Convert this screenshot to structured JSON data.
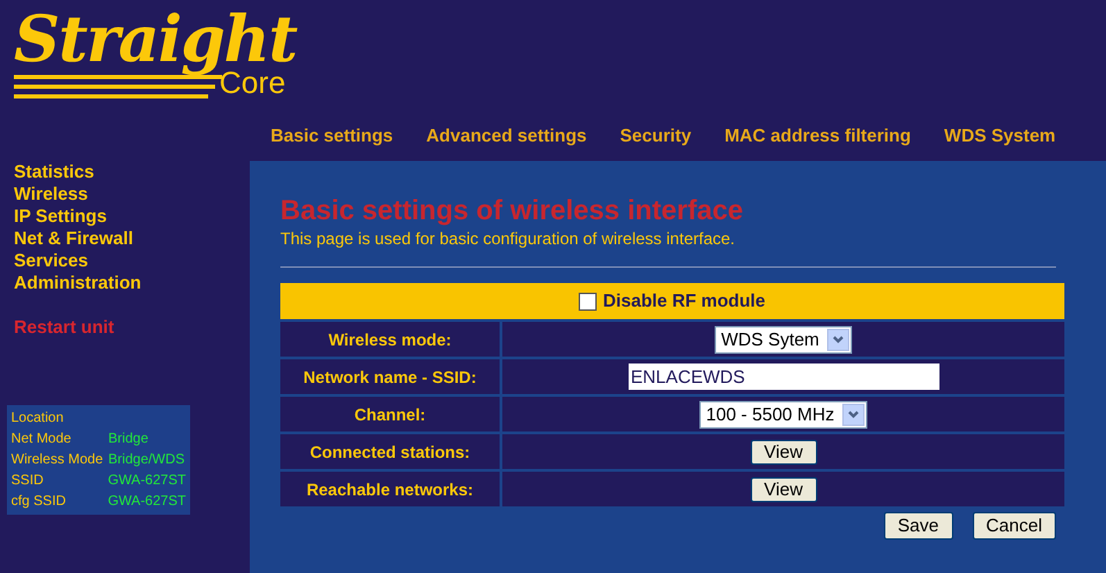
{
  "logo": {
    "name": "Straight",
    "tagline": "Core"
  },
  "nav": [
    "Basic settings",
    "Advanced settings",
    "Security",
    "MAC address filtering",
    "WDS System"
  ],
  "sidebar": {
    "items": [
      {
        "label": "Statistics",
        "kind": "link"
      },
      {
        "label": "Wireless",
        "kind": "link"
      },
      {
        "label": "IP Settings",
        "kind": "link"
      },
      {
        "label": "Net & Firewall",
        "kind": "link"
      },
      {
        "label": "Services",
        "kind": "link"
      },
      {
        "label": "Administration",
        "kind": "link"
      },
      {
        "label": "Restart unit",
        "kind": "action"
      }
    ]
  },
  "status": {
    "title": "Location",
    "rows": [
      {
        "label": "Net Mode",
        "value": "Bridge"
      },
      {
        "label": "Wireless Mode",
        "value": "Bridge/WDS"
      },
      {
        "label": "SSID",
        "value": "GWA-627ST"
      },
      {
        "label": "cfg SSID",
        "value": "GWA-627ST"
      }
    ]
  },
  "page": {
    "title": "Basic settings of wireless interface",
    "description": "This page is used for basic configuration of wireless interface."
  },
  "disable_rf": {
    "label": "Disable RF module",
    "checked": false
  },
  "rows": [
    {
      "label": "Wireless mode:",
      "kind": "select",
      "value": "WDS Sytem"
    },
    {
      "label": "Network name - SSID:",
      "kind": "input",
      "value": "ENLACEWDS"
    },
    {
      "label": "Channel:",
      "kind": "select",
      "value": "100 - 5500 MHz"
    },
    {
      "label": "Connected stations:",
      "kind": "button",
      "value": "View"
    },
    {
      "label": "Reachable networks:",
      "kind": "button",
      "value": "View"
    }
  ],
  "buttons": [
    "Save",
    "Cancel"
  ]
}
